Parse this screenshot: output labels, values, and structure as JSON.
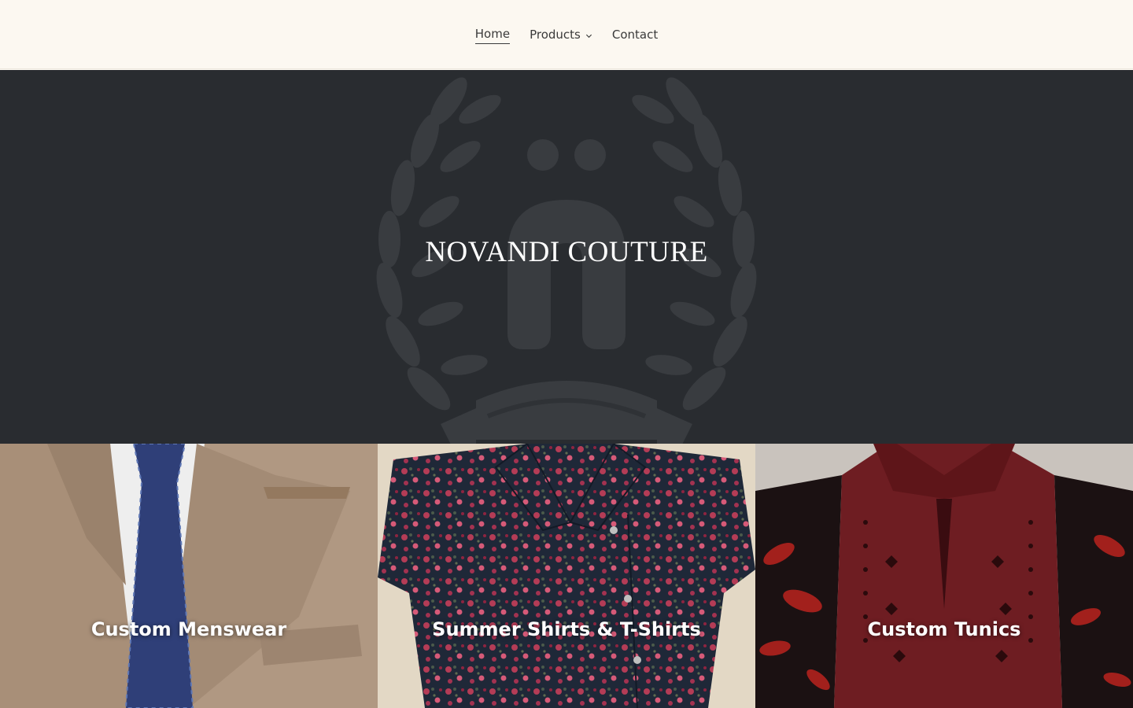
{
  "nav": {
    "items": [
      {
        "label": "Home",
        "active": true
      },
      {
        "label": "Products",
        "has_dropdown": true
      },
      {
        "label": "Contact"
      }
    ]
  },
  "hero": {
    "title": "NOVANDI COUTURE",
    "background": "#292c30",
    "emblem_icon": "laurel-wreath-logo"
  },
  "collections": [
    {
      "label": "Custom Menswear",
      "image": "beige-suit-blue-tie"
    },
    {
      "label": "Summer Shirts & T-Shirts",
      "image": "navy-floral-shirt"
    },
    {
      "label": "Custom Tunics",
      "image": "maroon-embroidered-tunic"
    }
  ],
  "colors": {
    "header_bg": "#fcf8f1",
    "nav_text": "#3a3a3a",
    "hero_bg": "#292c30"
  }
}
